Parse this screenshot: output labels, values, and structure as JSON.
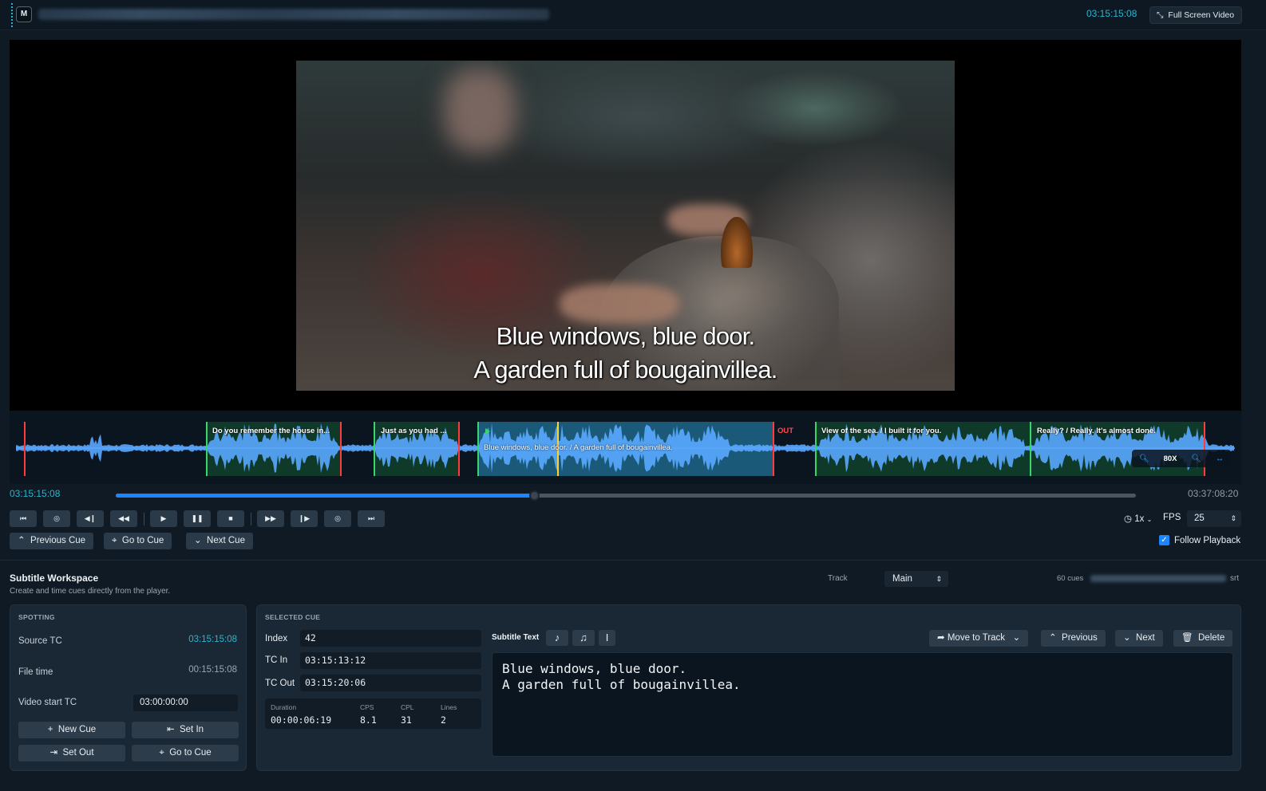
{
  "app": {
    "logo_letter": "M",
    "timecode": "03:15:15:08",
    "fullscreen_label": "Full Screen Video"
  },
  "video": {
    "subtitle_line1": "Blue windows, blue door.",
    "subtitle_line2": "A garden full of bougainvillea."
  },
  "waveform": {
    "cues": [
      {
        "label": "Do you remember the house in..."
      },
      {
        "label": "Just as you had ..."
      },
      {
        "label": "Blue windows, blue door. / A garden full of bougainvillea."
      },
      {
        "label": "View of the sea. / I built it for you."
      },
      {
        "label": "Really? / Really. It's almost done."
      }
    ],
    "out_label": "OUT",
    "zoom_value": "80X"
  },
  "scrubber": {
    "current": "03:15:15:08",
    "end": "03:37:08:20",
    "progress_fraction": 0.41
  },
  "transport": {
    "speed": "1x",
    "fps_label": "FPS",
    "fps_value": "25",
    "prev_cue": "Previous Cue",
    "goto_cue": "Go to Cue",
    "next_cue": "Next Cue",
    "follow_playback": "Follow Playback"
  },
  "workspace": {
    "title": "Subtitle Workspace",
    "subtitle": "Create and time cues directly from the player.",
    "track_label": "Track",
    "track_value": "Main",
    "cue_count": "60 cues",
    "file_ext": "srt"
  },
  "spotting": {
    "title": "SPOTTING",
    "source_tc_label": "Source TC",
    "source_tc": "03:15:15:08",
    "file_time_label": "File time",
    "file_time": "00:15:15:08",
    "video_start_label": "Video start TC",
    "video_start": "03:00:00:00",
    "new_cue": "New Cue",
    "set_in": "Set In",
    "set_out": "Set Out",
    "goto_cue": "Go to Cue"
  },
  "selected_cue": {
    "title": "SELECTED CUE",
    "index_label": "Index",
    "index": "42",
    "tc_in_label": "TC In",
    "tc_in": "03:15:13:12",
    "tc_out_label": "TC Out",
    "tc_out": "03:15:20:06",
    "duration_label": "Duration",
    "duration": "00:00:06:19",
    "cps_label": "CPS",
    "cps": "8.1",
    "cpl_label": "CPL",
    "cpl": "31",
    "lines_label": "Lines",
    "lines": "2",
    "subtitle_text_label": "Subtitle Text",
    "move_to_track": "Move to Track",
    "previous": "Previous",
    "next": "Next",
    "delete": "Delete",
    "text_line1": "Blue windows, blue door.",
    "text_line2": "A garden full of bougainvillea."
  }
}
